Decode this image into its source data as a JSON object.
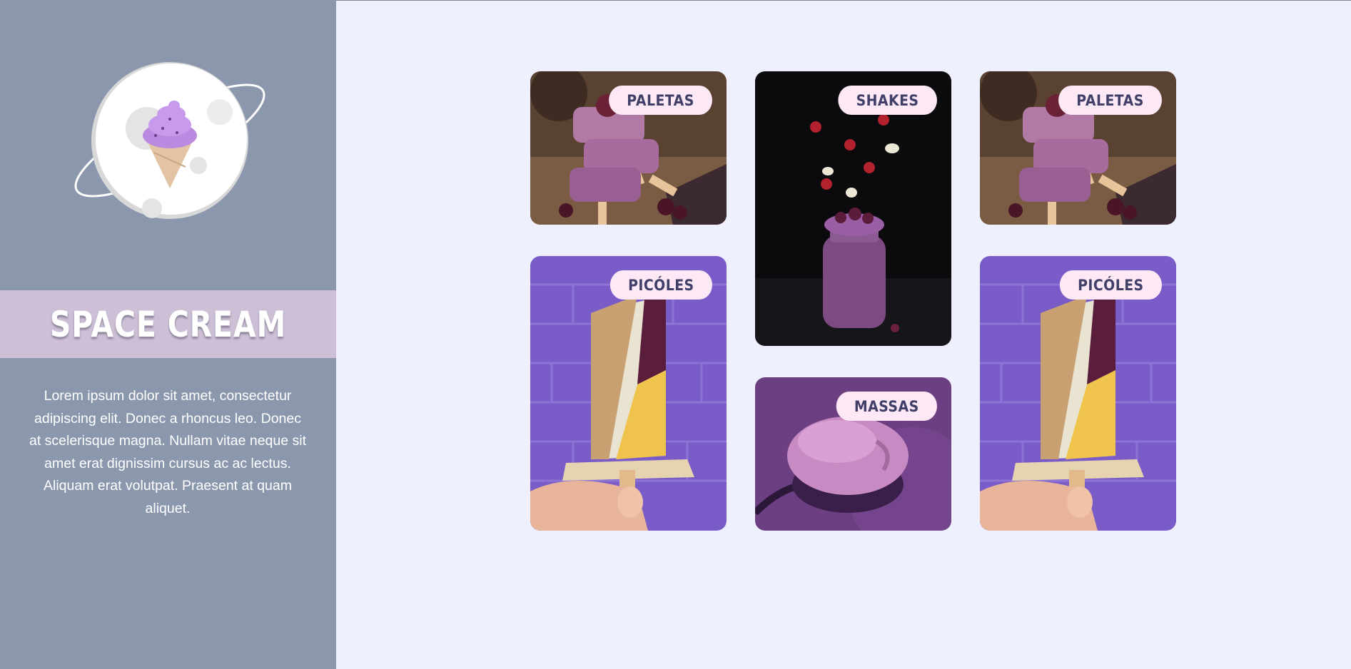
{
  "brand": {
    "title": "SPACE CREAM",
    "description": "Lorem ipsum dolor sit amet, consectetur adipiscing elit. Donec a rhoncus leo. Donec at scelerisque magna. Nullam vitae neque sit amet erat dignissim cursus ac ac lectus. Aliquam erat volutpat. Praesent at quam aliquet.",
    "logo_icon": "ice-cream-planet-icon"
  },
  "gallery": {
    "cards": [
      {
        "label": "PALETAS",
        "image": "stacked-berry-ice-bars"
      },
      {
        "label": "SHAKES",
        "image": "berry-shake-jar-falling-fruit"
      },
      {
        "label": "PALETAS",
        "image": "stacked-berry-ice-bars"
      },
      {
        "label": "PICÓLES",
        "image": "popsicle-in-hand-purple-bricks"
      },
      {
        "label": "MASSAS",
        "image": "ice-cream-scoop-spoon"
      },
      {
        "label": "PICÓLES",
        "image": "popsicle-in-hand-purple-bricks"
      }
    ]
  },
  "colors": {
    "sidebar": "#8b97ad",
    "band": "#cdbfd6",
    "page": "#eef0fd",
    "tag_bg": "#fde8f6",
    "tag_text": "#3f3f68"
  }
}
